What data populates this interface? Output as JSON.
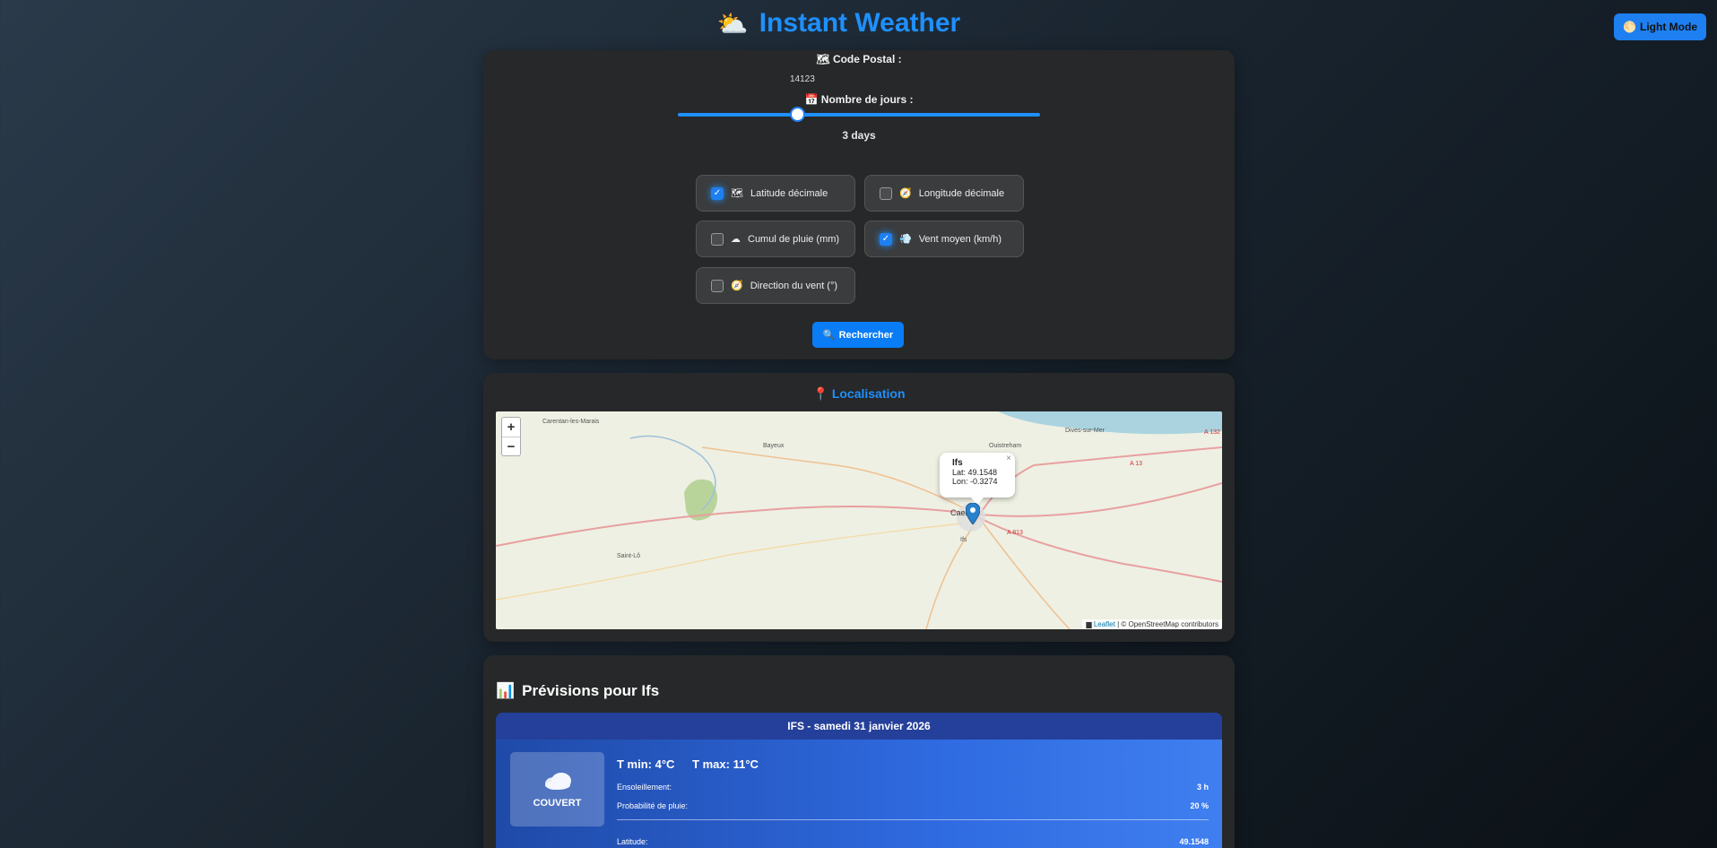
{
  "header": {
    "title": "Instant Weather",
    "title_icon": "sun-cloud-icon",
    "mode_label": "Light Mode"
  },
  "search": {
    "postal_label": "Code Postal :",
    "postal_value": "14123",
    "days_label": "Nombre de jours :",
    "days_fraction": 0.33,
    "days_value": "3 days",
    "options": [
      {
        "label": "Latitude décimale",
        "checked": true,
        "icon": "map-icon"
      },
      {
        "label": "Longitude décimale",
        "checked": false,
        "icon": "compass-icon"
      },
      {
        "label": "Cumul de pluie (mm)",
        "checked": false,
        "icon": "rain-cloud-icon"
      },
      {
        "label": "Vent moyen (km/h)",
        "checked": true,
        "icon": "wind-icon"
      },
      {
        "label": "Direction du vent (°)",
        "checked": false,
        "icon": "compass-icon"
      }
    ],
    "button_label": "Rechercher"
  },
  "location": {
    "title": "Localisation",
    "zoom_in": "+",
    "zoom_out": "−",
    "popup": {
      "name": "Ifs",
      "lat": "Lat: 49.1548",
      "lon": "Lon: -0.3274",
      "close": "×"
    },
    "attribution_link": "Leaflet",
    "attribution_text": "| © OpenStreetMap contributors",
    "places": [
      "Carentan-les-Marais",
      "Bayeux",
      "Ouistreham",
      "Dives-sur-Mer",
      "Caen",
      "Ifs",
      "Saint-Lô",
      "A 13",
      "A 813",
      "A 132"
    ]
  },
  "forecast": {
    "title": "Prévisions pour Ifs",
    "day": {
      "header": "IFS - samedi 31 janvier 2026",
      "condition": "COUVERT",
      "tmin": "T min: 4°C",
      "tmax": "T max: 11°C",
      "sun_label": "Ensoleillement:",
      "sun_value": "3 h",
      "rain_label": "Probabilité de pluie:",
      "rain_value": "20 %",
      "lat_label": "Latitude:",
      "lat_value": "49.1548"
    }
  },
  "colors": {
    "accent": "#1e90ff",
    "card": "#262829",
    "forecast": "#2f6ae0"
  }
}
